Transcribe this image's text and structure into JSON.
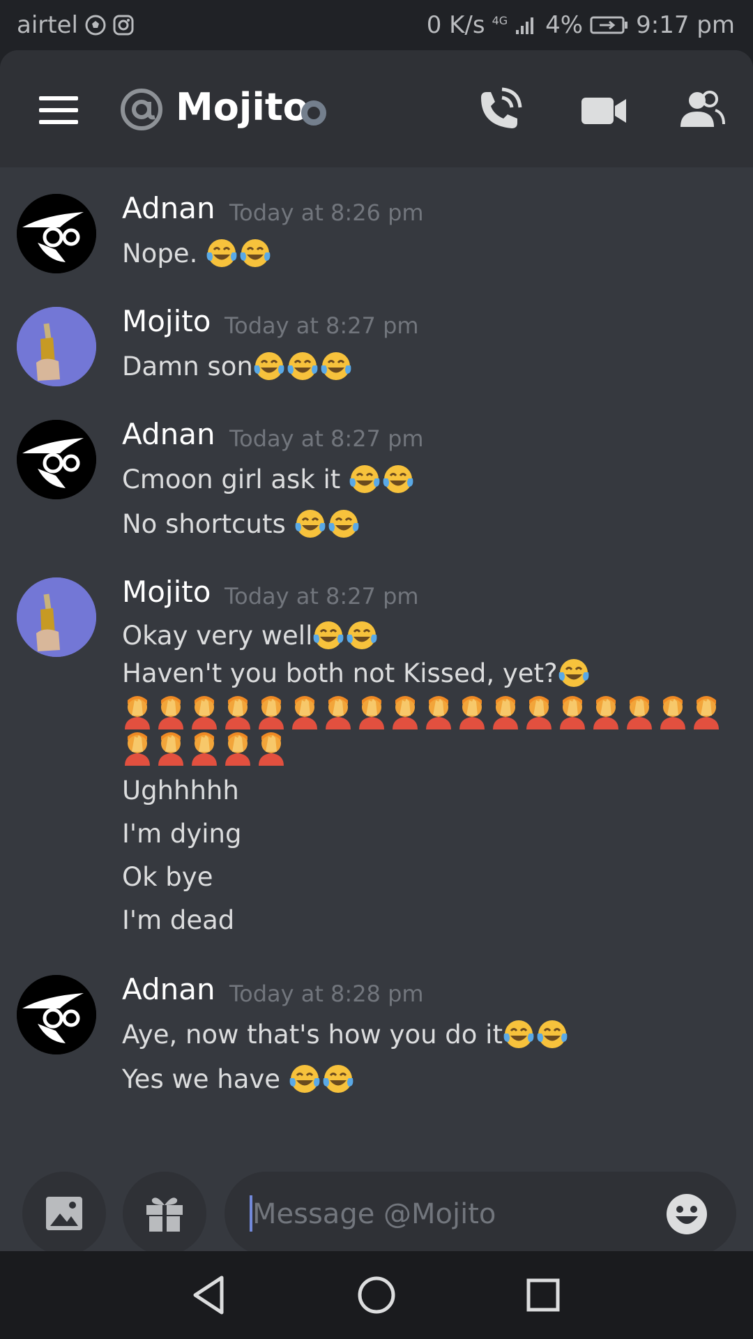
{
  "status_bar": {
    "carrier": "airtel",
    "speed": "0 K/s",
    "network": "4G",
    "battery": "4%",
    "time": "9:17 pm"
  },
  "header": {
    "channel_name": "Mojito",
    "icons": [
      "menu-icon",
      "at-icon",
      "status-indicator",
      "call-icon",
      "video-icon",
      "members-icon"
    ]
  },
  "messages": [
    {
      "author": "Adnan",
      "timestamp": "Today at 8:26 pm",
      "avatar": "spy-hat-avatar",
      "lines": [
        {
          "text": "Nope. ",
          "emoji": [
            "laugh-cry",
            "laugh-cry"
          ]
        }
      ]
    },
    {
      "author": "Mojito",
      "timestamp": "Today at 8:27 pm",
      "avatar": "bottle-avatar",
      "lines": [
        {
          "text": "Damn son",
          "emoji": [
            "laugh-cry",
            "laugh-cry",
            "laugh-cry"
          ]
        }
      ]
    },
    {
      "author": "Adnan",
      "timestamp": "Today at 8:27 pm",
      "avatar": "spy-hat-avatar",
      "lines": [
        {
          "text": "Cmoon girl ask it ",
          "emoji": [
            "laugh-cry",
            "laugh-cry"
          ]
        },
        {
          "text": "No shortcuts ",
          "emoji": [
            "laugh-cry",
            "laugh-cry"
          ]
        }
      ]
    },
    {
      "author": "Mojito",
      "timestamp": "Today at 8:27 pm",
      "avatar": "bottle-avatar",
      "lines": [
        {
          "text": "Okay very well",
          "emoji": [
            "laugh-cry",
            "laugh-cry"
          ]
        },
        {
          "text": "Haven't you both not Kissed, yet?",
          "emoji": [
            "laugh-cry"
          ]
        },
        {
          "text": "",
          "facepalm_count": 18
        },
        {
          "text": "",
          "facepalm_count": 5
        },
        {
          "text": "Ughhhhh"
        },
        {
          "text": "I'm dying"
        },
        {
          "text": "Ok bye"
        },
        {
          "text": "I'm dead"
        }
      ]
    },
    {
      "author": "Adnan",
      "timestamp": "Today at 8:28 pm",
      "avatar": "spy-hat-avatar",
      "lines": [
        {
          "text": "Aye, now that's how you do it",
          "emoji": [
            "laugh-cry",
            "laugh-cry"
          ]
        },
        {
          "text": "Yes we have ",
          "emoji": [
            "laugh-cry",
            "laugh-cry"
          ]
        }
      ]
    }
  ],
  "composer": {
    "placeholder": "Message @Mojito"
  },
  "colors": {
    "background": "#36393f",
    "header": "#2f3136",
    "text": "#dcddde",
    "muted": "#72767d",
    "accent": "#7289da"
  }
}
